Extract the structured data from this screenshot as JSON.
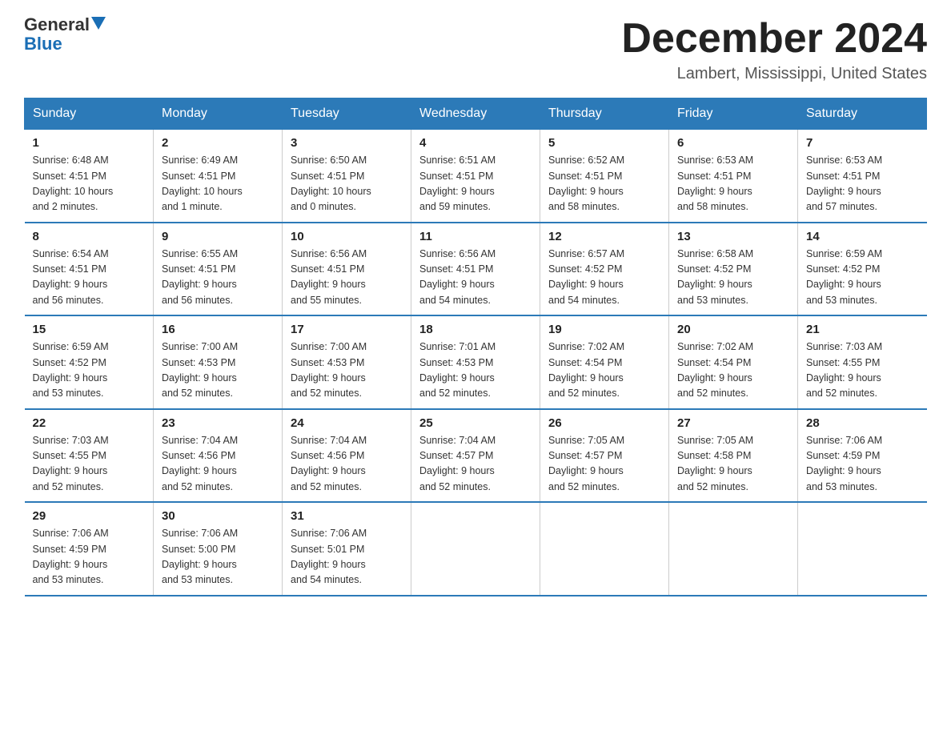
{
  "logo": {
    "general": "General",
    "blue": "Blue"
  },
  "header": {
    "month_title": "December 2024",
    "location": "Lambert, Mississippi, United States"
  },
  "days_of_week": [
    "Sunday",
    "Monday",
    "Tuesday",
    "Wednesday",
    "Thursday",
    "Friday",
    "Saturday"
  ],
  "weeks": [
    [
      {
        "day": "1",
        "sunrise": "6:48 AM",
        "sunset": "4:51 PM",
        "daylight": "10 hours and 2 minutes."
      },
      {
        "day": "2",
        "sunrise": "6:49 AM",
        "sunset": "4:51 PM",
        "daylight": "10 hours and 1 minute."
      },
      {
        "day": "3",
        "sunrise": "6:50 AM",
        "sunset": "4:51 PM",
        "daylight": "10 hours and 0 minutes."
      },
      {
        "day": "4",
        "sunrise": "6:51 AM",
        "sunset": "4:51 PM",
        "daylight": "9 hours and 59 minutes."
      },
      {
        "day": "5",
        "sunrise": "6:52 AM",
        "sunset": "4:51 PM",
        "daylight": "9 hours and 58 minutes."
      },
      {
        "day": "6",
        "sunrise": "6:53 AM",
        "sunset": "4:51 PM",
        "daylight": "9 hours and 58 minutes."
      },
      {
        "day": "7",
        "sunrise": "6:53 AM",
        "sunset": "4:51 PM",
        "daylight": "9 hours and 57 minutes."
      }
    ],
    [
      {
        "day": "8",
        "sunrise": "6:54 AM",
        "sunset": "4:51 PM",
        "daylight": "9 hours and 56 minutes."
      },
      {
        "day": "9",
        "sunrise": "6:55 AM",
        "sunset": "4:51 PM",
        "daylight": "9 hours and 56 minutes."
      },
      {
        "day": "10",
        "sunrise": "6:56 AM",
        "sunset": "4:51 PM",
        "daylight": "9 hours and 55 minutes."
      },
      {
        "day": "11",
        "sunrise": "6:56 AM",
        "sunset": "4:51 PM",
        "daylight": "9 hours and 54 minutes."
      },
      {
        "day": "12",
        "sunrise": "6:57 AM",
        "sunset": "4:52 PM",
        "daylight": "9 hours and 54 minutes."
      },
      {
        "day": "13",
        "sunrise": "6:58 AM",
        "sunset": "4:52 PM",
        "daylight": "9 hours and 53 minutes."
      },
      {
        "day": "14",
        "sunrise": "6:59 AM",
        "sunset": "4:52 PM",
        "daylight": "9 hours and 53 minutes."
      }
    ],
    [
      {
        "day": "15",
        "sunrise": "6:59 AM",
        "sunset": "4:52 PM",
        "daylight": "9 hours and 53 minutes."
      },
      {
        "day": "16",
        "sunrise": "7:00 AM",
        "sunset": "4:53 PM",
        "daylight": "9 hours and 52 minutes."
      },
      {
        "day": "17",
        "sunrise": "7:00 AM",
        "sunset": "4:53 PM",
        "daylight": "9 hours and 52 minutes."
      },
      {
        "day": "18",
        "sunrise": "7:01 AM",
        "sunset": "4:53 PM",
        "daylight": "9 hours and 52 minutes."
      },
      {
        "day": "19",
        "sunrise": "7:02 AM",
        "sunset": "4:54 PM",
        "daylight": "9 hours and 52 minutes."
      },
      {
        "day": "20",
        "sunrise": "7:02 AM",
        "sunset": "4:54 PM",
        "daylight": "9 hours and 52 minutes."
      },
      {
        "day": "21",
        "sunrise": "7:03 AM",
        "sunset": "4:55 PM",
        "daylight": "9 hours and 52 minutes."
      }
    ],
    [
      {
        "day": "22",
        "sunrise": "7:03 AM",
        "sunset": "4:55 PM",
        "daylight": "9 hours and 52 minutes."
      },
      {
        "day": "23",
        "sunrise": "7:04 AM",
        "sunset": "4:56 PM",
        "daylight": "9 hours and 52 minutes."
      },
      {
        "day": "24",
        "sunrise": "7:04 AM",
        "sunset": "4:56 PM",
        "daylight": "9 hours and 52 minutes."
      },
      {
        "day": "25",
        "sunrise": "7:04 AM",
        "sunset": "4:57 PM",
        "daylight": "9 hours and 52 minutes."
      },
      {
        "day": "26",
        "sunrise": "7:05 AM",
        "sunset": "4:57 PM",
        "daylight": "9 hours and 52 minutes."
      },
      {
        "day": "27",
        "sunrise": "7:05 AM",
        "sunset": "4:58 PM",
        "daylight": "9 hours and 52 minutes."
      },
      {
        "day": "28",
        "sunrise": "7:06 AM",
        "sunset": "4:59 PM",
        "daylight": "9 hours and 53 minutes."
      }
    ],
    [
      {
        "day": "29",
        "sunrise": "7:06 AM",
        "sunset": "4:59 PM",
        "daylight": "9 hours and 53 minutes."
      },
      {
        "day": "30",
        "sunrise": "7:06 AM",
        "sunset": "5:00 PM",
        "daylight": "9 hours and 53 minutes."
      },
      {
        "day": "31",
        "sunrise": "7:06 AM",
        "sunset": "5:01 PM",
        "daylight": "9 hours and 54 minutes."
      },
      null,
      null,
      null,
      null
    ]
  ],
  "labels": {
    "sunrise": "Sunrise:",
    "sunset": "Sunset:",
    "daylight": "Daylight:"
  }
}
